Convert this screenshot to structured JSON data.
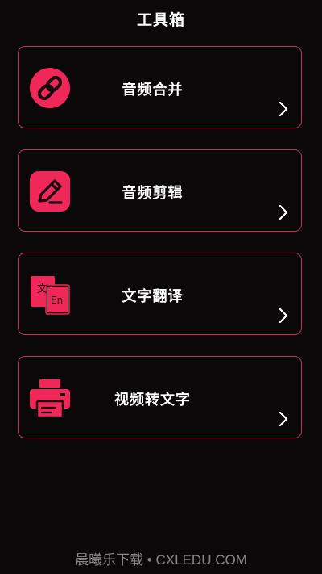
{
  "header": {
    "title": "工具箱"
  },
  "tools": [
    {
      "label": "音频合并",
      "icon": "link-icon"
    },
    {
      "label": "音频剪辑",
      "icon": "edit-pencil-icon"
    },
    {
      "label": "文字翻译",
      "icon": "translate-icon",
      "icon_text_zh": "文",
      "icon_text_en": "En"
    },
    {
      "label": "视频转文字",
      "icon": "printer-icon"
    }
  ],
  "watermark": "晨曦乐下载 • CXLEDU.COM",
  "colors": {
    "background": "#0a0809",
    "accent": "#f0285a",
    "card_border": "#c23552",
    "text": "#ffffff"
  }
}
